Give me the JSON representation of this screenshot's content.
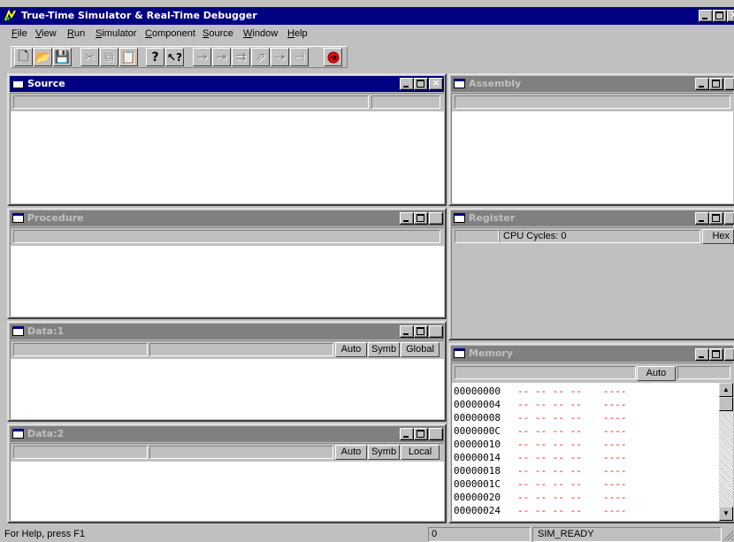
{
  "app": {
    "title": "True-Time Simulator & Real-Time Debugger"
  },
  "menu": [
    "File",
    "View",
    "Run",
    "Simulator",
    "Component",
    "Source",
    "Window",
    "Help"
  ],
  "toolbar": {
    "icons": [
      "new-file-icon",
      "open-folder-icon",
      "save-icon",
      "cut-icon",
      "copy-icon",
      "paste-icon",
      "help-icon",
      "context-help-icon",
      "start-icon",
      "single-step-icon",
      "step-over-icon",
      "step-out-icon",
      "assembly-step-icon",
      "halt-icon",
      "reset-icon"
    ]
  },
  "windows": {
    "source": {
      "title": "Source"
    },
    "assembly": {
      "title": "Assembly"
    },
    "procedure": {
      "title": "Procedure"
    },
    "register": {
      "title": "Register",
      "cycles_label": "CPU Cycles:",
      "cycles_value": "0",
      "format_button": "Hex"
    },
    "data1": {
      "title": "Data:1",
      "auto": "Auto",
      "symb": "Symb",
      "scope": "Global"
    },
    "data2": {
      "title": "Data:2",
      "auto": "Auto",
      "symb": "Symb",
      "scope": "Local"
    },
    "memory": {
      "title": "Memory",
      "auto": "Auto",
      "rows": [
        {
          "addr": "00000000",
          "bytes": "-- -- -- --",
          "ascii": "----"
        },
        {
          "addr": "00000004",
          "bytes": "-- -- -- --",
          "ascii": "----"
        },
        {
          "addr": "00000008",
          "bytes": "-- -- -- --",
          "ascii": "----"
        },
        {
          "addr": "0000000C",
          "bytes": "-- -- -- --",
          "ascii": "----"
        },
        {
          "addr": "00000010",
          "bytes": "-- -- -- --",
          "ascii": "----"
        },
        {
          "addr": "00000014",
          "bytes": "-- -- -- --",
          "ascii": "----"
        },
        {
          "addr": "00000018",
          "bytes": "-- -- -- --",
          "ascii": "----"
        },
        {
          "addr": "0000001C",
          "bytes": "-- -- -- --",
          "ascii": "----"
        },
        {
          "addr": "00000020",
          "bytes": "-- -- -- --",
          "ascii": "----"
        },
        {
          "addr": "00000024",
          "bytes": "-- -- -- --",
          "ascii": "----"
        }
      ]
    }
  },
  "status": {
    "help_text": "For Help, press F1",
    "counter": "0",
    "state": "SIM_READY"
  },
  "colors": {
    "active_title": "#000080",
    "inactive_title": "#808080",
    "face": "#c0c0c0",
    "memory_value": "#ff0000"
  }
}
